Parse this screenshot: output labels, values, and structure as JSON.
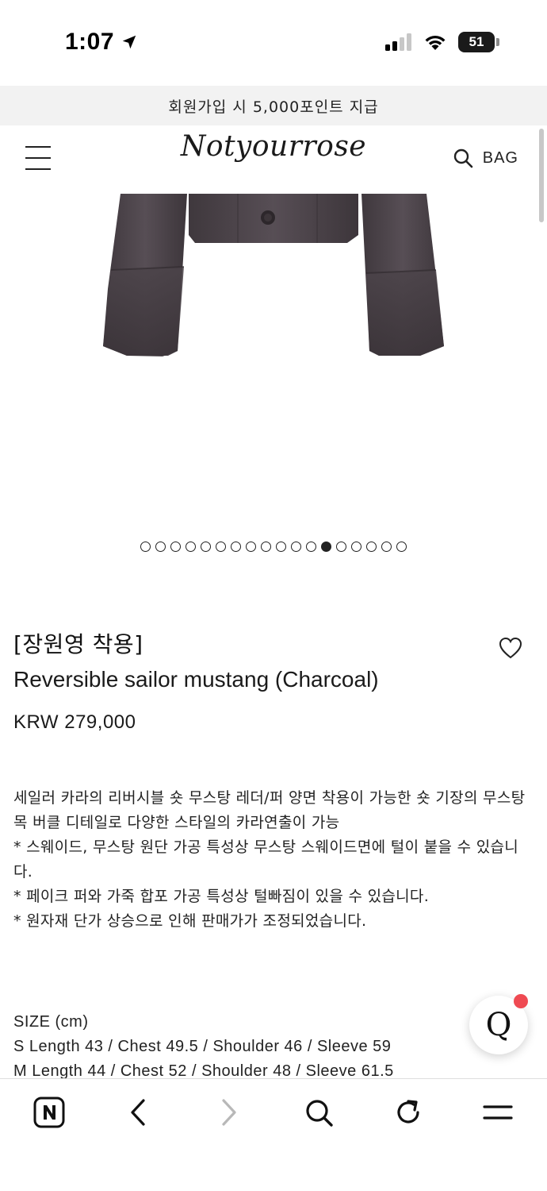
{
  "status_bar": {
    "time": "1:07",
    "battery_percent": "51",
    "icons": [
      "location-arrow-icon",
      "cellular-signal-icon",
      "wifi-icon",
      "battery-icon"
    ]
  },
  "promo_banner": {
    "text": "회원가입 시 5,000포인트 지급"
  },
  "header": {
    "logo_text": "Notyourrose",
    "bag_label": "BAG",
    "icons": [
      "hamburger-menu-icon",
      "search-icon"
    ]
  },
  "carousel": {
    "total_slides": 18,
    "active_index": 12
  },
  "product": {
    "tag": "[장원영 착용]",
    "name": "Reversible sailor mustang (Charcoal)",
    "price": "KRW 279,000",
    "description_lines": [
      "세일러 카라의 리버시블 숏 무스탕 레더/퍼 양면 착용이 가능한 숏 기장의 무스탕",
      "목 버클 디테일로 다양한 스타일의 카라연출이 가능",
      "* 스웨이드, 무스탕 원단 가공 특성상 무스탕 스웨이드면에 털이 붙을 수 있습니다.",
      "* 페이크 퍼와 가죽 합포 가공 특성상 털빠짐이 있을 수 있습니다.",
      "* 원자재 단가 상승으로 인해 판매가가 조정되었습니다."
    ],
    "size_title": "SIZE (cm)",
    "sizes": [
      "S Length 43 / Chest 49.5 / Shoulder 46 / Sleeve 59",
      "M Length 44 / Chest 52 / Shoulder 48 / Sleeve 61.5"
    ]
  },
  "chat_button": {
    "label": "Q",
    "badge_color": "#ef4a52"
  },
  "browser_bar": {
    "items": [
      "naver-home-icon",
      "back-icon",
      "forward-icon",
      "search-icon",
      "refresh-icon",
      "menu-icon"
    ]
  },
  "colors": {
    "promo_bg": "#f2f2f2",
    "jacket": "#4a4248",
    "text": "#1a1a1a"
  }
}
